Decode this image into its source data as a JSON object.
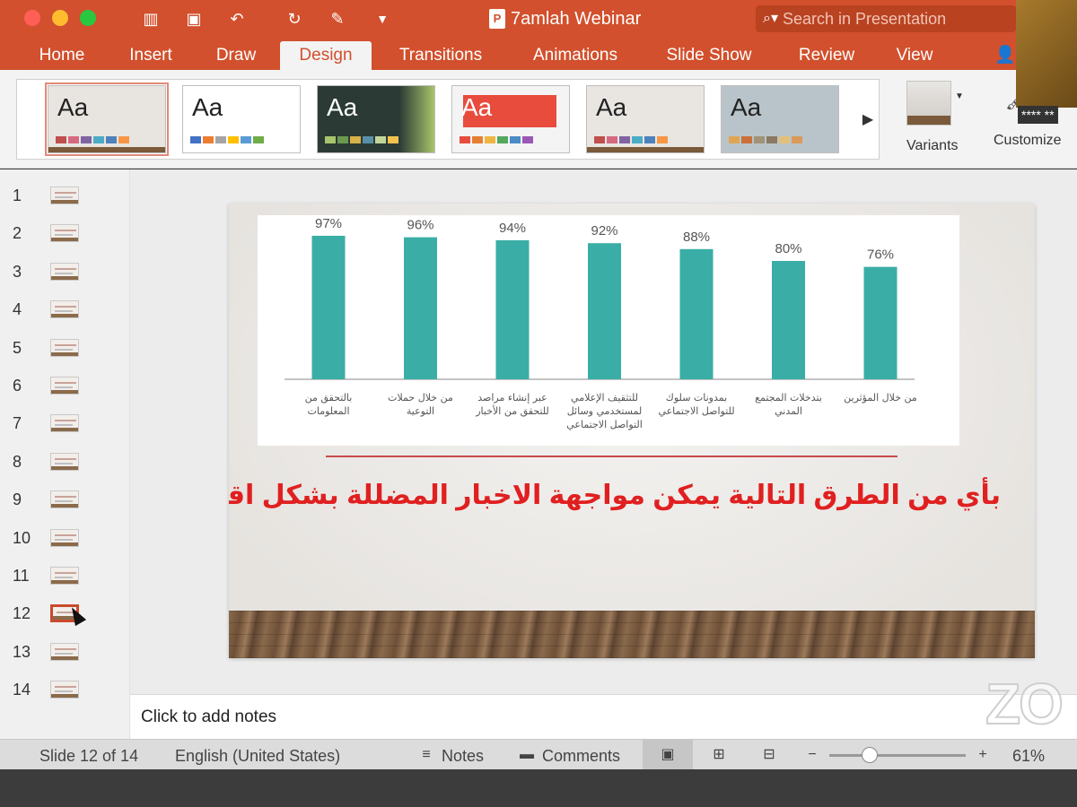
{
  "window": {
    "title": "7amlah Webinar",
    "search_placeholder": "Search in Presentation"
  },
  "tabs": [
    {
      "label": "Home"
    },
    {
      "label": "Insert"
    },
    {
      "label": "Draw"
    },
    {
      "label": "Design",
      "active": true
    },
    {
      "label": "Transitions"
    },
    {
      "label": "Animations"
    },
    {
      "label": "Slide Show"
    },
    {
      "label": "Review"
    },
    {
      "label": "View"
    }
  ],
  "ribbon": {
    "theme_sample": "Aa",
    "variants_label": "Variants",
    "customize_label": "Customize"
  },
  "themes": [
    {
      "bg": "#e8e5e1",
      "text": "#222222",
      "swatches": [
        "#c0504d",
        "#d5697f",
        "#8064a2",
        "#4bacc6",
        "#4f81bd",
        "#f79646"
      ],
      "selected": true
    },
    {
      "bg": "#ffffff",
      "text": "#222222",
      "swatches": [
        "#4472c4",
        "#ed7d31",
        "#a5a5a5",
        "#ffc000",
        "#5b9bd5",
        "#70ad47"
      ]
    },
    {
      "bg": "#2b3a35",
      "text": "#ffffff",
      "swatches": [
        "#a9c46c",
        "#6b9a4f",
        "#d8b14a",
        "#5a8fa8",
        "#c2d69b",
        "#f2c14e"
      ]
    },
    {
      "bg": "#f4f4f4",
      "text": "#ffffff",
      "swatches": [
        "#e84c3d",
        "#e77f33",
        "#f0b543",
        "#52a85e",
        "#4a8bc6",
        "#9b59b6"
      ]
    },
    {
      "bg": "#e9e6e2",
      "text": "#222222",
      "swatches": [
        "#c0504d",
        "#d5697f",
        "#8064a2",
        "#4bacc6",
        "#4f81bd",
        "#f79646"
      ]
    },
    {
      "bg": "#b9c4ca",
      "text": "#222222",
      "swatches": [
        "#e0a553",
        "#c9703b",
        "#a19376",
        "#8a7a62",
        "#e2c07a",
        "#d99a5a"
      ]
    }
  ],
  "thumbnails": [
    {
      "num": "1"
    },
    {
      "num": "2"
    },
    {
      "num": "3"
    },
    {
      "num": "4"
    },
    {
      "num": "5"
    },
    {
      "num": "6"
    },
    {
      "num": "7"
    },
    {
      "num": "8"
    },
    {
      "num": "9"
    },
    {
      "num": "10"
    },
    {
      "num": "11"
    },
    {
      "num": "12",
      "current": true
    },
    {
      "num": "13"
    },
    {
      "num": "14"
    }
  ],
  "slide": {
    "question": "بأي من الطرق التالية يمكن مواجهة الاخبار المضللة بشكل اقوى؟"
  },
  "chart_data": {
    "type": "bar",
    "categories": [
      "بالتحقق من المعلومات",
      "من خلال حملات التوعية",
      "عبر إنشاء مراصد للتحقق من الأخبار",
      "للتثقيف الإعلامي لمستخدمي وسائل التواصل الاجتماعي",
      "بمدونات سلوك للتواصل الاجتماعي",
      "بتدخلات المجتمع المدني",
      "من خلال المؤثرين"
    ],
    "values": [
      97,
      96,
      94,
      92,
      88,
      80,
      76
    ],
    "data_labels": [
      "97%",
      "96%",
      "94%",
      "92%",
      "88%",
      "80%",
      "76%"
    ],
    "ylim": [
      0,
      100
    ],
    "bar_color": "#3aaea6",
    "grid": false
  },
  "notes": {
    "placeholder": "Click to add notes"
  },
  "status": {
    "slide_info": "Slide 12 of 14",
    "language": "English (United States)",
    "notes_label": "Notes",
    "comments_label": "Comments",
    "zoom": "61%"
  },
  "colors": {
    "accent": "#d2502d",
    "question_red": "#e02020"
  },
  "overlay": {
    "watermark": "ZO",
    "stars": "**** **"
  }
}
